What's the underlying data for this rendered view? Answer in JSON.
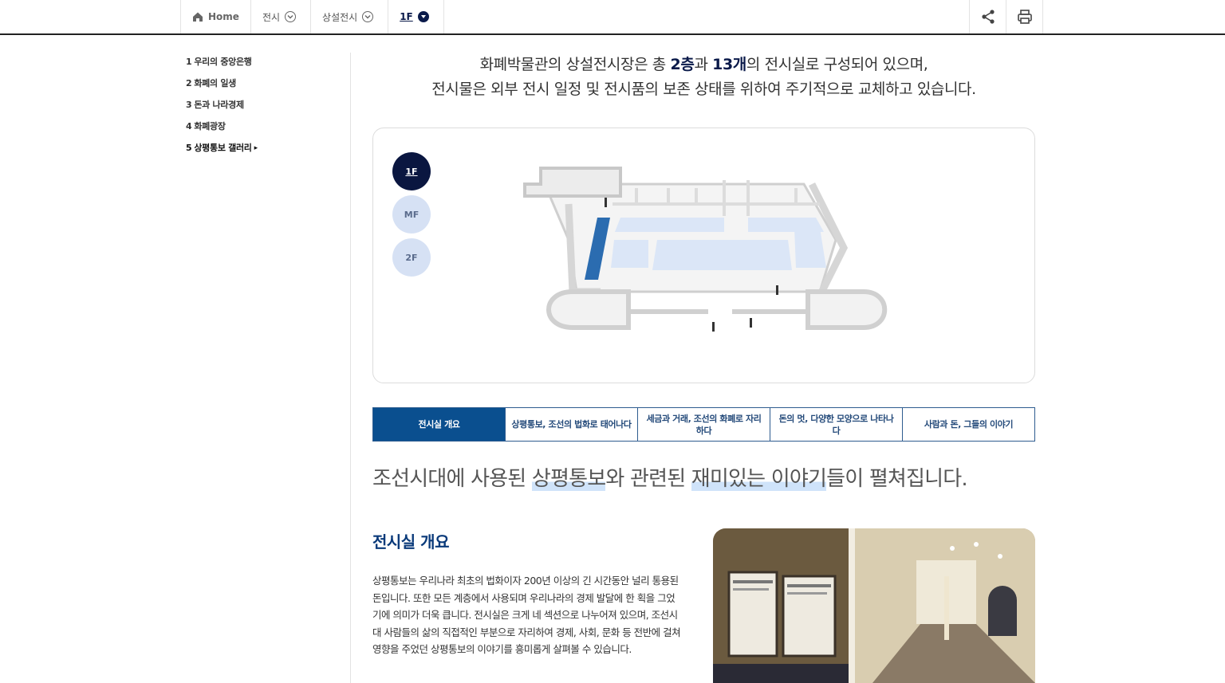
{
  "breadcrumb": {
    "home": "Home",
    "level1": "전시",
    "level2": "상설전시",
    "current": "1F"
  },
  "tools": {
    "share_icon": "share-icon",
    "print_icon": "print-icon"
  },
  "leftnav": {
    "items": [
      {
        "num": "1",
        "label": "우리의 중앙은행"
      },
      {
        "num": "2",
        "label": "화폐의 일생"
      },
      {
        "num": "3",
        "label": "돈과 나라경제"
      },
      {
        "num": "4",
        "label": "화폐광장"
      },
      {
        "num": "5",
        "label": "상평통보 갤러리",
        "arrow": "▸"
      }
    ]
  },
  "intro": {
    "l1a": "화폐박물관의 상설전시장은 총 ",
    "l1b": "2층",
    "l1c": "과 ",
    "l1d": "13개",
    "l1e": "의 전시실로 구성되어 있으며,",
    "l2": "전시물은 외부 전시 일정 및 전시품의 보존 상태를 위하여 주기적으로 교체하고 있습니다."
  },
  "floors": [
    "1F",
    "MF",
    "2F"
  ],
  "tabs": [
    {
      "label": "전시실 개요"
    },
    {
      "label": "상평통보, 조선의 법화로 태어나다"
    },
    {
      "label": "세금과 거래, 조선의 화폐로 자리하다"
    },
    {
      "label": "돈의 멋, 다양한 모양으로 나타나다"
    },
    {
      "label": "사람과 돈, 그들의 이야기"
    }
  ],
  "headline": {
    "a": "조선시대에 사용된 ",
    "b": "상평통보",
    "c": "와 관련된 ",
    "d": "재미있는 이야기",
    "e": "들이 펼쳐집니다."
  },
  "section": {
    "title": "전시실 개요",
    "body": "상평통보는 우리나라 최초의 법화이자 200년 이상의 긴 시간동안 널리 통용된 돈입니다. 또한 모든 계층에서 사용되며 우리나라의 경제 발달에 한 획을 그었기에 의미가 더욱 큽니다. 전시실은 크게 네 섹션으로 나누어져 있으며, 조선시대 사람들의 삶의 직접적인 부분으로 자리하여 경제, 사회, 문화 등 전반에 걸쳐 영향을 주었던 상평통보의 이야기를 흥미롭게 살펴볼 수 있습니다."
  },
  "colors": {
    "navy": "#0a1640",
    "accent_blue": "#0a4f8f",
    "room_highlight": "#2b6cb0",
    "room_fill": "#dbe6f7"
  }
}
